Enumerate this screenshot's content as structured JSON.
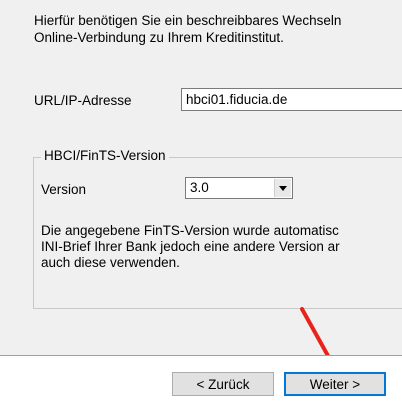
{
  "intro": {
    "line1": "Hierfür benötigen Sie ein beschreibbares Wechseln",
    "line2": "Online-Verbindung zu Ihrem Kreditinstitut."
  },
  "url": {
    "label": "URL/IP-Adresse",
    "value": "hbci01.fiducia.de"
  },
  "hbci_group": {
    "title": "HBCI/FinTS-Version",
    "version_label": "Version",
    "version_value": "3.0",
    "info_line1": "Die angegebene FinTS-Version wurde automatisc",
    "info_line2": "INI-Brief Ihrer Bank jedoch eine andere Version ar",
    "info_line3": "auch diese verwenden."
  },
  "buttons": {
    "back_label": "< Zurück",
    "next_label": "Weiter >"
  },
  "colors": {
    "annotation_arrow": "#e8231b",
    "focus_border": "#0078d7"
  },
  "icons": {
    "dropdown": "chevron-down-icon",
    "annotation": "red-arrow-icon"
  }
}
